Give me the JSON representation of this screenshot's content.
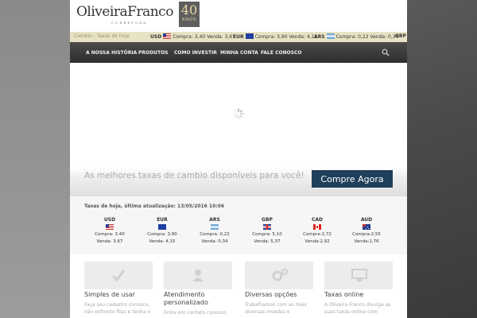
{
  "header": {
    "logo_text": "OliveiraFranco",
    "logo_subtitle": "CORRETORA",
    "badge_number": "40",
    "badge_text": "ANOS"
  },
  "ticker": {
    "crumb": "Cambio - Taxas de hoje",
    "items": [
      {
        "code": "USD",
        "compra": "Compra: 3,40",
        "venda": "Venda: 3,67",
        "flag": "usa-flag-icon"
      },
      {
        "code": "EUR",
        "compra": "Compra: 3,90",
        "venda": "Venda: 4,15",
        "flag": "eu-flag-icon"
      },
      {
        "code": "ARS",
        "compra": "Compra: 0,22",
        "venda": "Venda: 0,34",
        "flag": "argentina-flag-icon"
      },
      {
        "code": "GBP"
      }
    ]
  },
  "nav": {
    "items": [
      "A NOSSA HISTÓRIA",
      "PRODUTOS",
      "COMO INVESTIR",
      "MINHA CONTA",
      "FALE CONOSCO"
    ],
    "search_icon": "search-icon"
  },
  "hero": {
    "tagline": "As melhores taxas de cambio disponíveis para você!",
    "button_label": "Compre Agora",
    "button_color": "#1f3f5a"
  },
  "rates": {
    "title": "Taxas de hoje, última atualização: 13/05/2016 10:06",
    "currencies": [
      {
        "code": "USD",
        "compra": "Compra: 3.40",
        "venda": "Venda: 3.67"
      },
      {
        "code": "EUR",
        "compra": "Compra: 3,90",
        "venda": "Venda: 4,15"
      },
      {
        "code": "ARS",
        "compra": "Compra: 0,22",
        "venda": "Venda: 0,34"
      },
      {
        "code": "GBP",
        "compra": "Compra: 5,10",
        "venda": "Venda: 5,37"
      },
      {
        "code": "CAD",
        "compra": "Compra:2,72",
        "venda": "Venda:2,92"
      },
      {
        "code": "AUD",
        "compra": "Compra:2,55",
        "venda": "Venda:2,76"
      }
    ]
  },
  "features": [
    {
      "title": "Simples de usar",
      "desc": "Faça seu cadastro conosco, não enfrente filas e tenha o",
      "icon": "check-icon"
    },
    {
      "title": "Atendimento personalizado",
      "desc": "Entre em contato conosco",
      "icon": "user-icon"
    },
    {
      "title": "Diversas opções",
      "desc": "Trabalhamos com as mais diversas moedas e",
      "icon": "gears-icon"
    },
    {
      "title": "Taxas online",
      "desc": "A Oliveira Franco divulga as suas taxas online com",
      "icon": "monitor-icon"
    }
  ]
}
